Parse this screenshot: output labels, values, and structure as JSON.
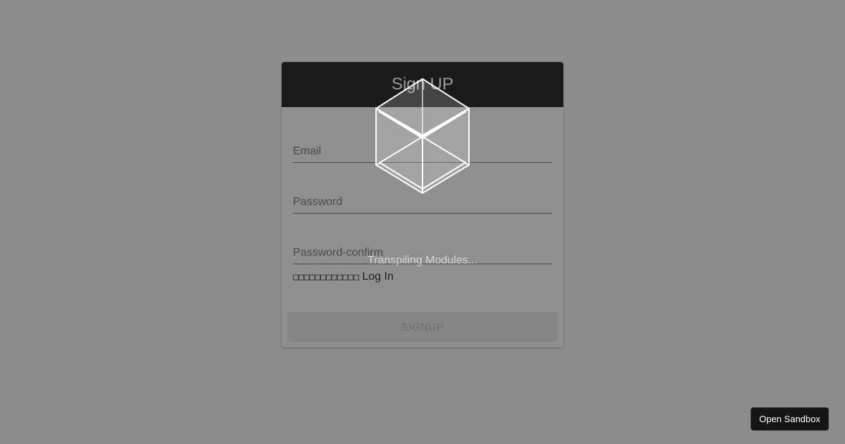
{
  "signup_form": {
    "title": "Sign UP",
    "email": {
      "placeholder": "Email",
      "value": ""
    },
    "password": {
      "placeholder": "Password",
      "value": ""
    },
    "password_confirm": {
      "placeholder": "Password-confirm",
      "value": ""
    },
    "login_prompt": "□□□□□□□□□□□□",
    "login_link": "Log In",
    "submit_label": "SIGNUP"
  },
  "loading_overlay": {
    "icon": "codesandbox-cube-icon",
    "message": "Transpiling Modules..."
  },
  "open_sandbox_label": "Open Sandbox",
  "colors": {
    "background": "#8c8c8c",
    "header": "#1b1b1b",
    "button_disabled": "#858585",
    "open_sandbox_bg": "#151515"
  }
}
